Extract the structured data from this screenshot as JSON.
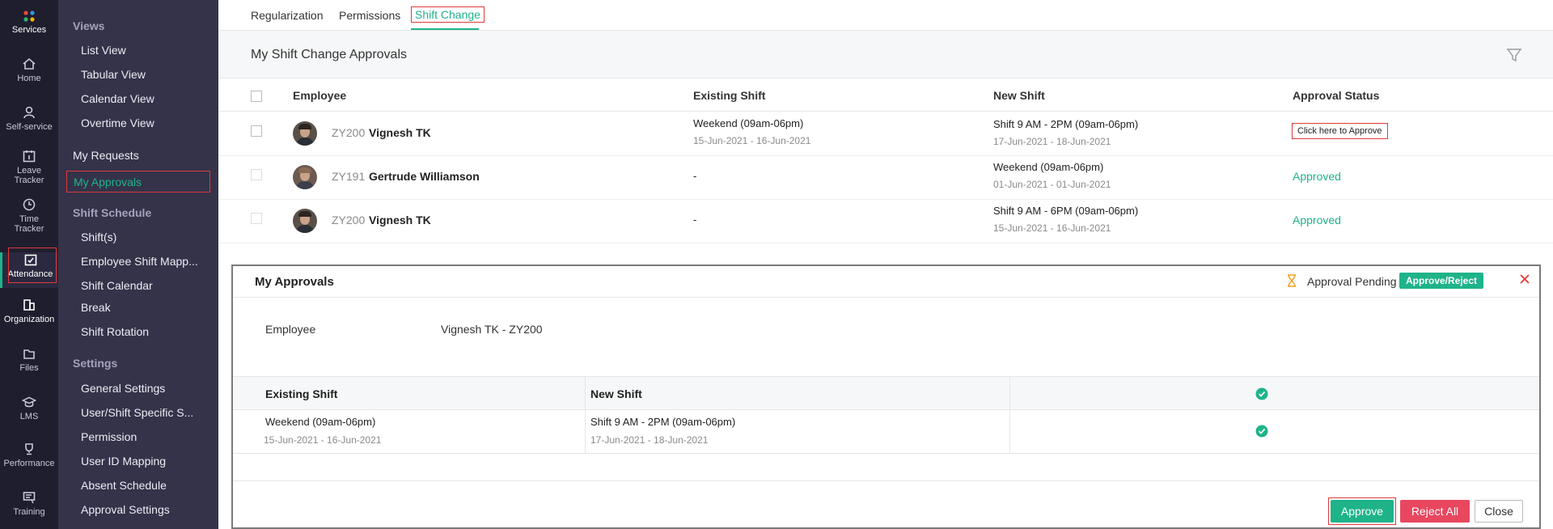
{
  "rail": {
    "services": "Services",
    "home": "Home",
    "self_service": "Self-service",
    "leave_tracker_1": "Leave",
    "leave_tracker_2": "Tracker",
    "time_tracker_1": "Time",
    "time_tracker_2": "Tracker",
    "attendance": "Attendance",
    "organization": "Organization",
    "files": "Files",
    "lms": "LMS",
    "performance": "Performance",
    "training": "Training"
  },
  "subnav": {
    "views_heading": "Views",
    "list_view": "List View",
    "tabular_view": "Tabular View",
    "calendar_view": "Calendar View",
    "overtime_view": "Overtime View",
    "my_requests": "My Requests",
    "my_approvals": "My Approvals",
    "shift_schedule_heading": "Shift Schedule",
    "shifts": "Shift(s)",
    "employee_shift_mapping": "Employee Shift Mapp...",
    "shift_calendar": "Shift Calendar",
    "break": "Break",
    "shift_rotation": "Shift Rotation",
    "settings_heading": "Settings",
    "general_settings": "General Settings",
    "user_shift_specific": "User/Shift Specific S...",
    "permission": "Permission",
    "user_id_mapping": "User ID Mapping",
    "absent_schedule": "Absent Schedule",
    "approval_settings": "Approval Settings"
  },
  "tabs": {
    "regularization": "Regularization",
    "permissions": "Permissions",
    "shift_change": "Shift Change"
  },
  "page": {
    "title": "My Shift Change Approvals"
  },
  "grid": {
    "headers": {
      "employee": "Employee",
      "existing_shift": "Existing Shift",
      "new_shift": "New Shift",
      "approval_status": "Approval Status"
    },
    "rows": [
      {
        "emp_id": "ZY200",
        "emp_name": "Vignesh TK",
        "existing_shift": "Weekend (09am-06pm)",
        "existing_dates": "15-Jun-2021 - 16-Jun-2021",
        "new_shift": "Shift 9 AM - 2PM (09am-06pm)",
        "new_dates": "17-Jun-2021 - 18-Jun-2021",
        "status": "Click here to Approve"
      },
      {
        "emp_id": "ZY191",
        "emp_name": "Gertrude Williamson",
        "existing_shift": "-",
        "new_shift": "Weekend (09am-06pm)",
        "new_dates": "01-Jun-2021 - 01-Jun-2021",
        "status": "Approved"
      },
      {
        "emp_id": "ZY200",
        "emp_name": "Vignesh TK",
        "existing_shift": "-",
        "new_shift": "Shift 9 AM - 6PM (09am-06pm)",
        "new_dates": "15-Jun-2021 - 16-Jun-2021",
        "status": "Approved"
      }
    ]
  },
  "dialog": {
    "title": "My Approvals",
    "pending": "Approval Pending",
    "approve_reject": "Approve/Reject",
    "employee_label": "Employee",
    "employee_value": "Vignesh TK - ZY200",
    "table": {
      "col_existing": "Existing Shift",
      "col_new": "New Shift",
      "row": {
        "existing_shift": "Weekend (09am-06pm)",
        "existing_dates": "15-Jun-2021 - 16-Jun-2021",
        "new_shift": "Shift 9 AM - 2PM (09am-06pm)",
        "new_dates": "17-Jun-2021 - 18-Jun-2021"
      }
    },
    "buttons": {
      "approve": "Approve",
      "reject_all": "Reject All",
      "close": "Close"
    }
  },
  "colors": {
    "accent": "#1fb38a",
    "danger": "#e8475f",
    "rail_bg": "#1f1e2e",
    "subnav_bg": "#34334a"
  }
}
